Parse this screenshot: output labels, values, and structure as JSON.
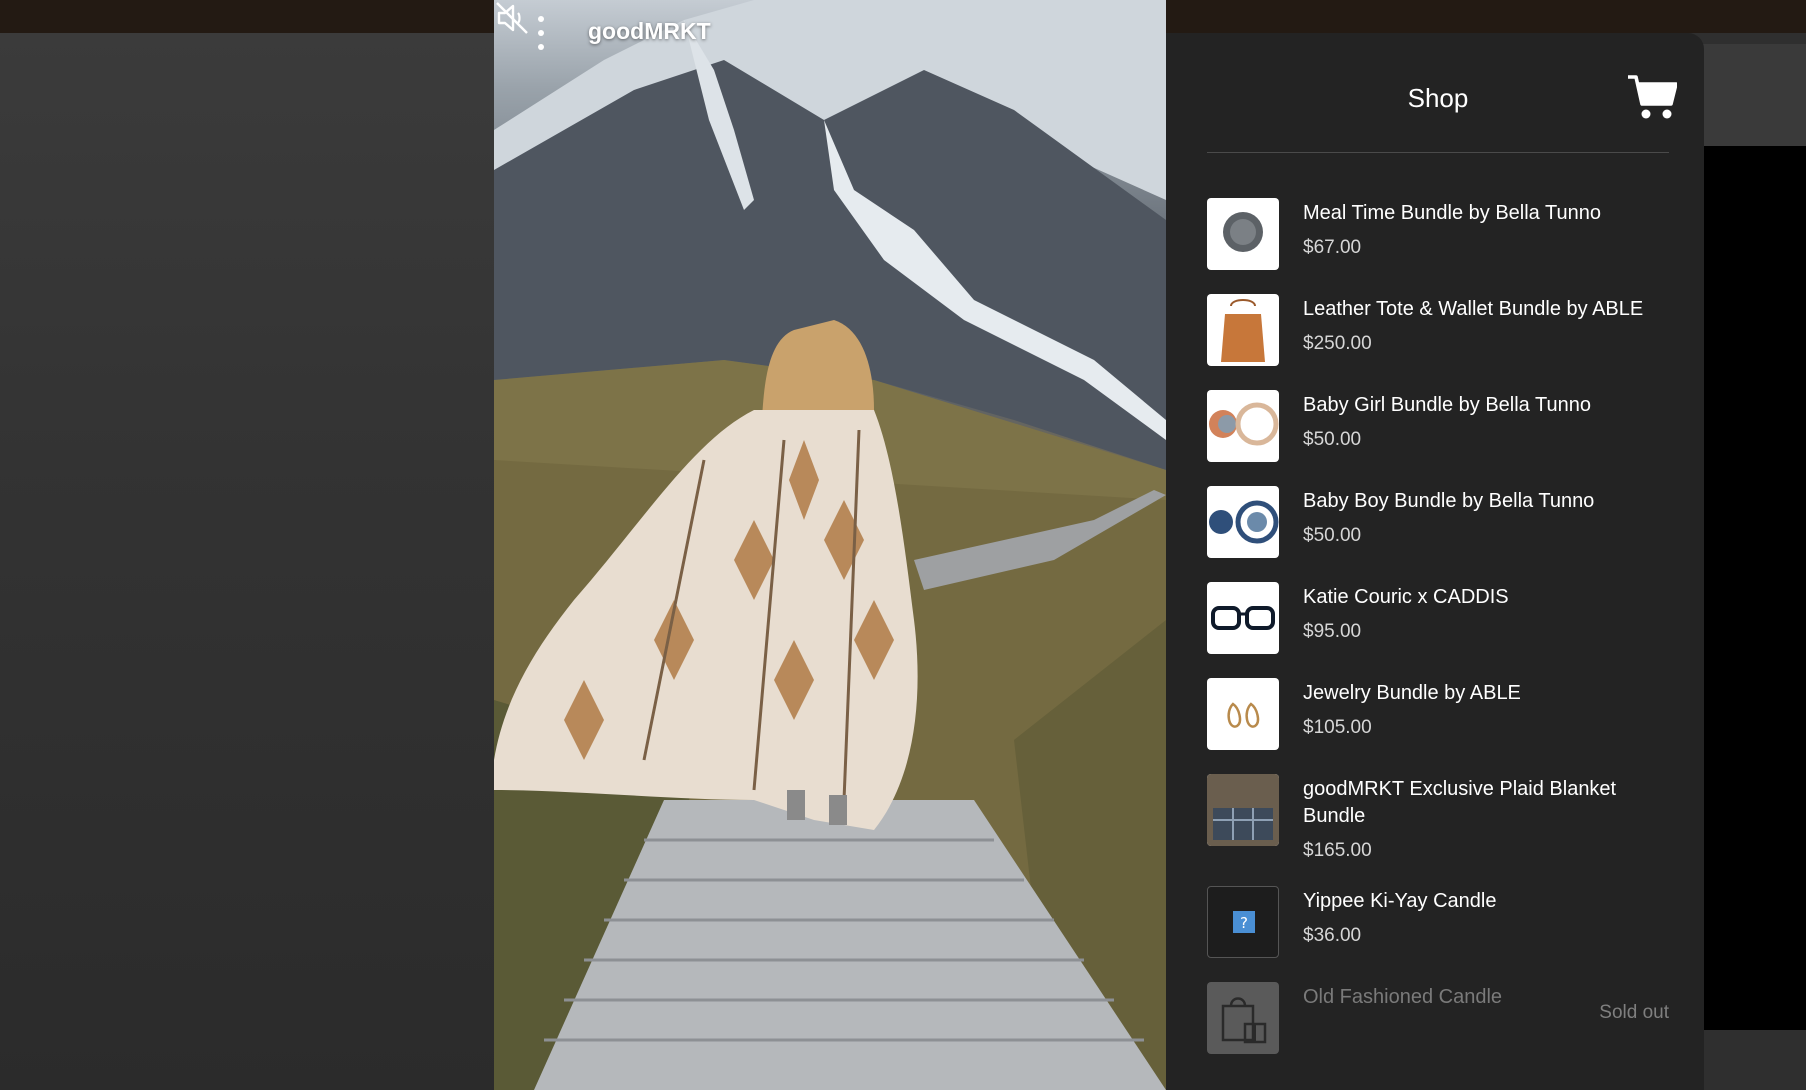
{
  "video": {
    "brand": "goodMRKT",
    "menu_icon": "kebab-menu-icon",
    "mute_icon": "muted-speaker-icon"
  },
  "shop": {
    "title": "Shop",
    "cart_icon": "shopping-cart-icon",
    "items": [
      {
        "name": "Meal Time Bundle by Bella Tunno",
        "price": "$67.00"
      },
      {
        "name": "Leather Tote & Wallet Bundle by ABLE",
        "price": "$250.00"
      },
      {
        "name": "Baby Girl Bundle by Bella Tunno",
        "price": "$50.00"
      },
      {
        "name": "Baby Boy Bundle by Bella Tunno",
        "price": "$50.00"
      },
      {
        "name": "Katie Couric x CADDIS",
        "price": "$95.00"
      },
      {
        "name": "Jewelry Bundle by ABLE",
        "price": "$105.00"
      },
      {
        "name": "goodMRKT Exclusive Plaid Blanket Bundle",
        "price": "$165.00"
      },
      {
        "name": "Yippee Ki-Yay Candle",
        "price": "$36.00"
      },
      {
        "name": "Old Fashioned Candle",
        "status": "Sold out"
      }
    ]
  }
}
